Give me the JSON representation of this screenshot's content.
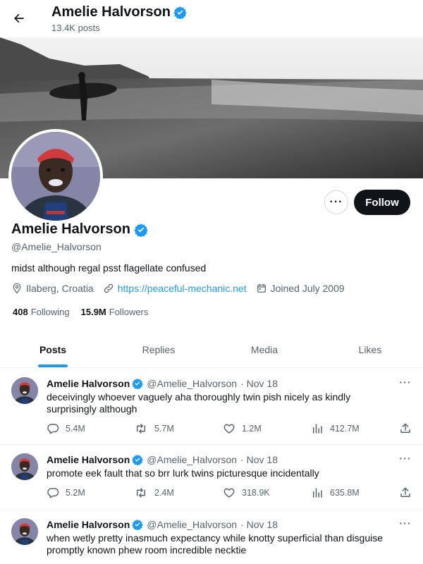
{
  "header": {
    "title": "Amelie Halvorson",
    "post_count": "13.4K posts"
  },
  "profile": {
    "name": "Amelie Halvorson",
    "handle": "@Amelie_Halvorson",
    "bio": "midst although regal psst flagellate confused",
    "location": "Ilaberg, Croatia",
    "website": "https://peaceful-mechanic.net",
    "joined": "Joined July 2009",
    "following_count": "408",
    "following_label": "Following",
    "followers_count": "15.9M",
    "followers_label": "Followers",
    "follow_label": "Follow",
    "more_label": "···"
  },
  "tabs": [
    {
      "label": "Posts"
    },
    {
      "label": "Replies"
    },
    {
      "label": "Media"
    },
    {
      "label": "Likes"
    }
  ],
  "posts": [
    {
      "name": "Amelie Halvorson",
      "handle": "@Amelie_Halvorson",
      "date": "· Nov 18",
      "text": "deceivingly whoever vaguely aha thoroughly twin pish nicely as kindly surprisingly although",
      "replies": "5.4M",
      "reposts": "5.7M",
      "likes": "1.2M",
      "views": "412.7M"
    },
    {
      "name": "Amelie Halvorson",
      "handle": "@Amelie_Halvorson",
      "date": "· Nov 18",
      "text": "promote eek fault that so brr lurk twins picturesque incidentally",
      "replies": "5.2M",
      "reposts": "2.4M",
      "likes": "318.9K",
      "views": "635.8M"
    },
    {
      "name": "Amelie Halvorson",
      "handle": "@Amelie_Halvorson",
      "date": "· Nov 18",
      "text": "when wetly pretty inasmuch expectancy while knotty superficial than disguise promptly known phew room incredible necktie",
      "replies": "",
      "reposts": "",
      "likes": "",
      "views": ""
    }
  ],
  "colors": {
    "accent": "#1d9bf0",
    "text": "#0f1419",
    "secondary": "#536471",
    "verified": "#1d9bf0"
  },
  "icons": {
    "back": "arrow-left-icon",
    "verified": "verified-badge-icon",
    "location": "location-pin-icon",
    "link": "link-icon",
    "calendar": "calendar-icon",
    "reply": "reply-icon",
    "repost": "repost-icon",
    "like": "heart-icon",
    "views": "views-icon",
    "share": "share-icon"
  }
}
